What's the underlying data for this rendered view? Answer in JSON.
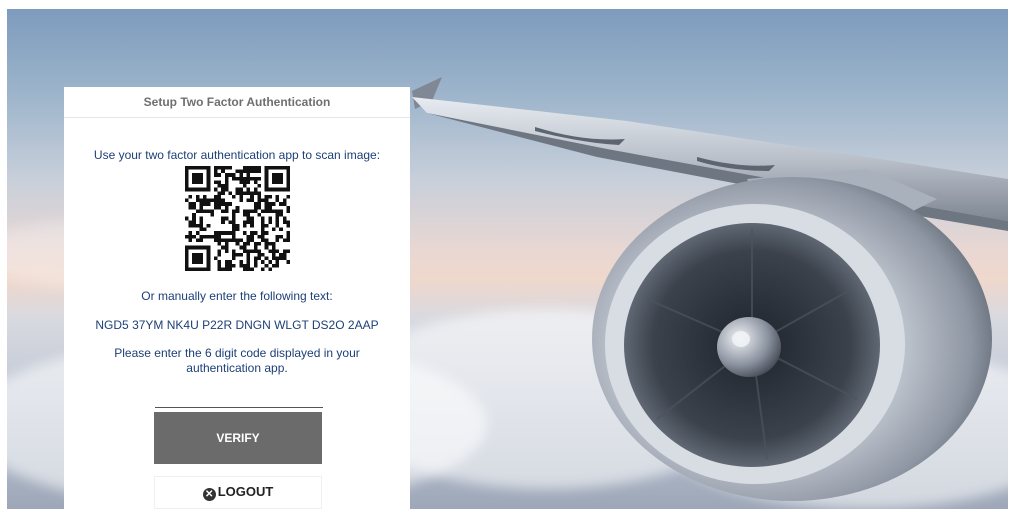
{
  "setup_panel": {
    "title": "Setup Two Factor Authentication",
    "scan_instruction": "Use your two factor authentication app to scan image:",
    "manual_instruction": "Or manually enter the following text:",
    "secret_key": "NGD5 37YM NK4U P22R DNGN WLGT DS2O 2AAP",
    "code_instruction_line1": "Please enter the 6 digit code displayed in your",
    "code_instruction_line2": "authentication app.",
    "code_input": {
      "value": "",
      "placeholder": ""
    },
    "verify_label": "VERIFY",
    "logout_label": "LOGOUT"
  },
  "icons": {
    "qr": "qr-code-icon",
    "logout": "logout-icon"
  },
  "colors": {
    "instruction_text": "#1d3f77",
    "verify_button": "#6b6b6b",
    "panel_background": "#ffffff"
  }
}
